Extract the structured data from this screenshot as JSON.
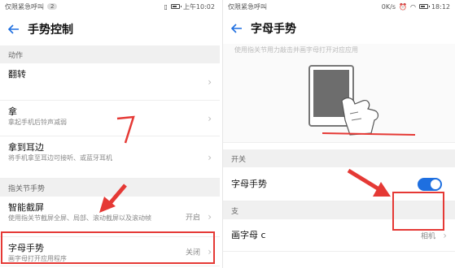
{
  "colors": {
    "accent": "#1e6fe0",
    "annotation_red": "#e53935",
    "section_bg": "#f0f0f0"
  },
  "left_screen": {
    "statusbar": {
      "carrier": "仅限紧急呼叫",
      "sim_badge": "2",
      "time": "上午10:02"
    },
    "title": "手势控制",
    "sections": [
      {
        "header": "动作",
        "items": [
          {
            "title": "翻转",
            "desc": ""
          },
          {
            "title": "拿",
            "desc": "拿起手机后铃声减弱"
          },
          {
            "title": "拿到耳边",
            "desc": "将手机拿至耳边可接听、或蓝牙耳机"
          }
        ]
      },
      {
        "header": "指关节手势",
        "items": [
          {
            "title": "智能截屏",
            "desc": "使用指关节截屏全屏、局部、滚动截屏以及滚动帧",
            "value": "开启"
          },
          {
            "title": "字母手势",
            "desc": "画字母打开应用程序",
            "value": "关闭"
          }
        ]
      }
    ]
  },
  "right_screen": {
    "statusbar": {
      "carrier": "仅限紧急呼叫",
      "speed": "0K/s",
      "time": "18:12"
    },
    "title": "字母手势",
    "illustration_caption": "使用指关节用力敲击并画字母打开对应应用",
    "switch_section": {
      "header": "开关",
      "toggle_label": "字母手势",
      "toggle_on": true
    },
    "apps_section": {
      "header": "支",
      "items": [
        {
          "title": "画字母 c",
          "value": "相机"
        }
      ]
    }
  }
}
